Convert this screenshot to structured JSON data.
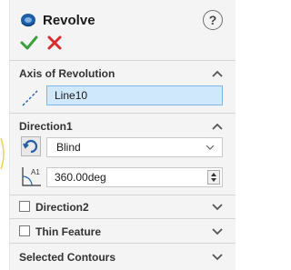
{
  "header": {
    "title": "Revolve",
    "help_label": "?"
  },
  "axis_of_revolution": {
    "title": "Axis of Revolution",
    "value": "Line10"
  },
  "direction1": {
    "title": "Direction1",
    "end_condition": "Blind",
    "angle": "360.00deg",
    "angle_icon_label": "A1"
  },
  "direction2": {
    "title": "Direction2"
  },
  "thin_feature": {
    "title": "Thin Feature"
  },
  "selected_contours": {
    "title": "Selected Contours"
  },
  "colors": {
    "ok_green": "#3aa13a",
    "cancel_red": "#d92b2b",
    "field_highlight": "#cfe8fb",
    "accent_blue": "#1e5fa8"
  }
}
